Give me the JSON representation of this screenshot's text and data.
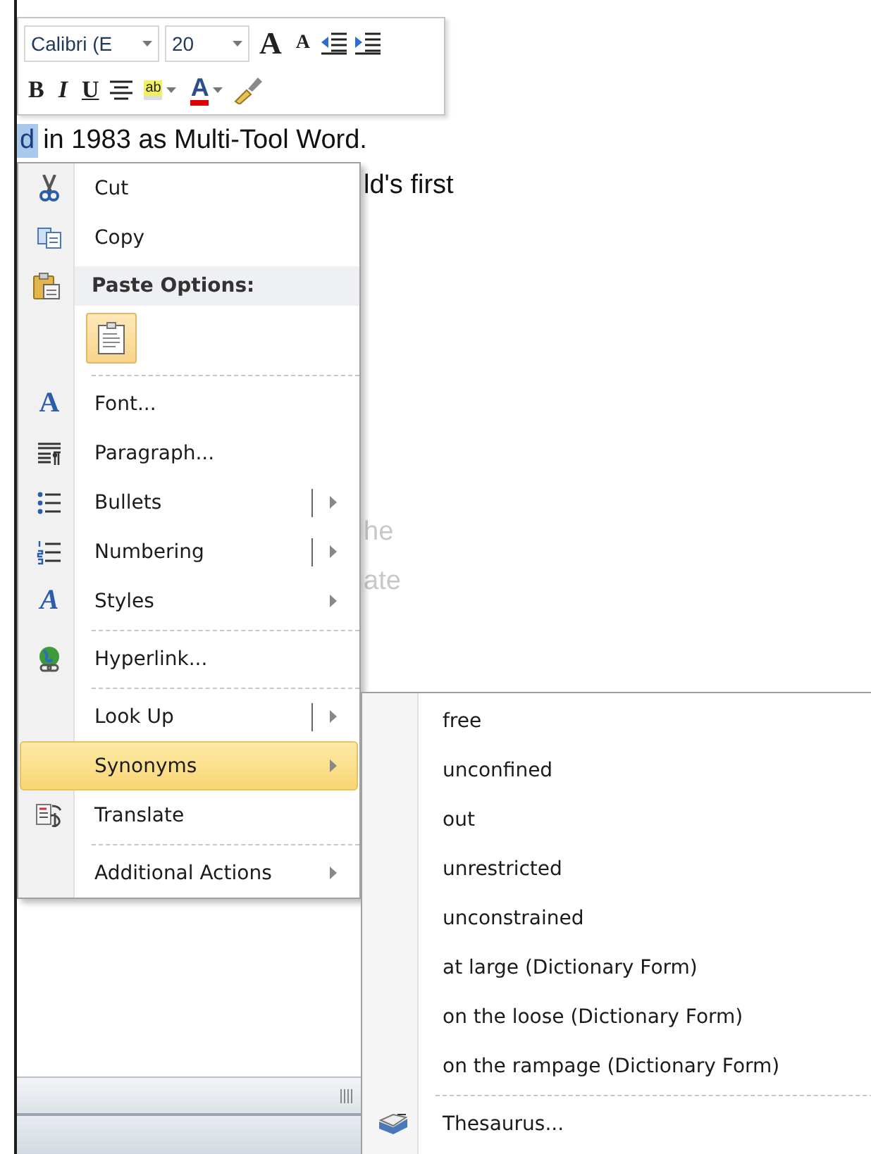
{
  "toolbar": {
    "font_field": {
      "value": "Calibri (E"
    },
    "size_field": {
      "value": "20"
    },
    "grow_font": "A",
    "shrink_font": "A",
    "bold": "B",
    "italic": "I",
    "underline": "U",
    "highlight": "ab",
    "font_color": "A"
  },
  "document": {
    "selected_text": "d",
    "first_line": "in 1983 as Multi-Tool Word.",
    "second_line": "ld's first",
    "lines_beside_menu": [
      "he",
      "ate"
    ]
  },
  "context_menu": {
    "items": [
      {
        "kind": "command",
        "label": "Cut",
        "selected": false
      },
      {
        "kind": "command",
        "label": "Copy",
        "selected": false
      },
      {
        "kind": "header",
        "label": "Paste Options:"
      },
      {
        "kind": "paste"
      },
      {
        "kind": "separator"
      },
      {
        "kind": "command",
        "label": "Font...",
        "icon_text": "A",
        "selected": false
      },
      {
        "kind": "command",
        "label": "Paragraph...",
        "selected": false
      },
      {
        "kind": "split",
        "label": "Bullets",
        "selected": false
      },
      {
        "kind": "split",
        "label": "Numbering",
        "selected": false
      },
      {
        "kind": "submenu",
        "label": "Styles",
        "icon_text": "A",
        "selected": false
      },
      {
        "kind": "separator"
      },
      {
        "kind": "command",
        "label": "Hyperlink...",
        "selected": false
      },
      {
        "kind": "separator"
      },
      {
        "kind": "split",
        "label": "Look Up",
        "selected": false
      },
      {
        "kind": "submenu",
        "label": "Synonyms",
        "selected": true
      },
      {
        "kind": "command",
        "label": "Translate",
        "selected": false
      },
      {
        "kind": "separator"
      },
      {
        "kind": "submenu",
        "label": "Additional Actions",
        "selected": false
      }
    ]
  },
  "submenu": {
    "items": [
      {
        "kind": "command",
        "label": "free"
      },
      {
        "kind": "command",
        "label": "unconfined"
      },
      {
        "kind": "command",
        "label": "out"
      },
      {
        "kind": "command",
        "label": "unrestricted"
      },
      {
        "kind": "command",
        "label": "unconstrained"
      },
      {
        "kind": "command",
        "label": "at large (Dictionary Form)"
      },
      {
        "kind": "command",
        "label": "on the loose (Dictionary Form)"
      },
      {
        "kind": "command",
        "label": "on the rampage (Dictionary Form)"
      },
      {
        "kind": "separator"
      },
      {
        "kind": "thesaurus",
        "label": "Thesaurus..."
      }
    ]
  }
}
